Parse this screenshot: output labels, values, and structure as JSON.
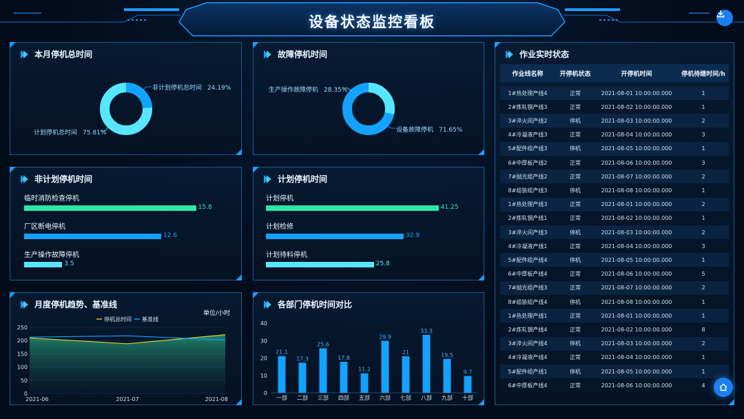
{
  "header": {
    "title": "设备状态监控看板"
  },
  "icons": {
    "download": "download-icon",
    "home": "home-icon",
    "panel_marker": "play-arrow-icon"
  },
  "colors": {
    "accent": "#1e9bff",
    "green": "#2ee6a6",
    "blue": "#13a2ff",
    "cyan": "#57e6ff",
    "yellow": "#d7d02c"
  },
  "panels": {
    "monthly_downtime": {
      "title": "本月停机总时间",
      "slices": [
        {
          "name": "非计划停机总时间",
          "pct": "24.19%",
          "value": 24.19,
          "color": "#13a2ff"
        },
        {
          "name": "计划停机总时间",
          "pct": "75.81%",
          "value": 75.81,
          "color": "#57e6ff"
        }
      ]
    },
    "fault_downtime": {
      "title": "故障停机时间",
      "slices": [
        {
          "name": "生产操作故障停机",
          "pct": "28.35%",
          "value": 28.35,
          "color": "#57e6ff"
        },
        {
          "name": "设备故障停机",
          "pct": "71.65%",
          "value": 71.65,
          "color": "#13a2ff"
        }
      ]
    },
    "unplanned": {
      "title": "非计划停机时间",
      "items": [
        {
          "label": "临时消防检查停机",
          "value": 15.8,
          "value_text": "15.8",
          "color": "#2ee6a6"
        },
        {
          "label": "厂区断电停机",
          "value": 12.6,
          "value_text": "12.6",
          "color": "#13a2ff"
        },
        {
          "label": "生产操作故障停机",
          "value": 3.5,
          "value_text": "3.5",
          "color": "#57e6ff"
        }
      ],
      "max": 20
    },
    "planned": {
      "title": "计划停机时间",
      "items": [
        {
          "label": "计划停机",
          "value": 41.25,
          "value_text": "41.25",
          "color": "#2ee6a6"
        },
        {
          "label": "计划检修",
          "value": 32.9,
          "value_text": "32.9",
          "color": "#13a2ff"
        },
        {
          "label": "计划待料停机",
          "value": 25.8,
          "value_text": "25.8",
          "color": "#57e6ff"
        }
      ],
      "max": 52
    },
    "trend": {
      "title": "月度停机趋势、基准线",
      "unit": "单位/小时",
      "legend": [
        "停机总时间",
        "基准线"
      ]
    },
    "dept": {
      "title": "各部门停机时间对比"
    },
    "realtime": {
      "title": "作业实时状态",
      "columns": [
        "作业线名称",
        "开停机状态",
        "开停机时间",
        "停机待继时间/h"
      ],
      "rows": [
        [
          "1#热处理产线4",
          "正常",
          "2021-08-01 10:00:00.000",
          "1"
        ],
        [
          "2#炼轧钢产线3",
          "正常",
          "2021-08-02 10:00:00.000",
          "1"
        ],
        [
          "3#淬火间产线2",
          "停机",
          "2021-08-03 10:00:00.000",
          "2"
        ],
        [
          "4#冷凝液产线3",
          "正常",
          "2021-08-04 10:00:00.000",
          "3"
        ],
        [
          "5#配件组产线3",
          "停机",
          "2021-08-05 10:00:00.000",
          "1"
        ],
        [
          "6#中厚板产线2",
          "正常",
          "2021-08-06 10:00:00.000",
          "3"
        ],
        [
          "7#抛光组产线2",
          "正常",
          "2021-08-07 10:00:00.000",
          "2"
        ],
        [
          "8#组装组产线3",
          "停机",
          "2021-08-08 10:00:00.000",
          "1"
        ],
        [
          "1#热处理产线3",
          "正常",
          "2021-08-01 10:00:00.000",
          "2"
        ],
        [
          "2#炼轧钢产线1",
          "正常",
          "2021-08-02 10:00:00.000",
          "1"
        ],
        [
          "3#淬火间产线3",
          "停机",
          "2021-08-03 10:00:00.000",
          "2"
        ],
        [
          "4#冷凝液产线1",
          "正常",
          "2021-08-04 10:00:00.000",
          "3"
        ],
        [
          "5#配件组产线4",
          "停机",
          "2021-08-05 10:00:00.000",
          "1"
        ],
        [
          "6#中厚板产线4",
          "正常",
          "2021-08-06 10:00:00.000",
          "5"
        ],
        [
          "7#抛光组产线3",
          "正常",
          "2021-08-07 10:00:00.000",
          "2"
        ],
        [
          "8#组装组产线4",
          "停机",
          "2021-08-08 10:00:00.000",
          "1"
        ],
        [
          "1#热处理产线1",
          "正常",
          "2021-08-01 10:00:00.000",
          "1"
        ],
        [
          "2#炼轧钢产线4",
          "正常",
          "2021-08-02 10:00:00.000",
          "8"
        ],
        [
          "3#淬火间产线4",
          "停机",
          "2021-08-03 10:00:00.000",
          "2"
        ],
        [
          "4#冷凝液产线4",
          "正常",
          "2021-08-04 10:00:00.000",
          "1"
        ],
        [
          "5#配件组产线1",
          "停机",
          "2021-08-05 10:00:00.000",
          "1"
        ],
        [
          "6#中厚板产线4",
          "正常",
          "2021-08-06 10:00:00.000",
          "4"
        ]
      ]
    }
  },
  "chart_data": [
    {
      "type": "area",
      "title": "月度停机趋势、基准线",
      "ylabel": "单位/小时",
      "x": [
        "2021-06",
        "2021-07",
        "2021-08"
      ],
      "ylim": [
        0,
        250
      ],
      "yticks": [
        0,
        50,
        100,
        150,
        200,
        250
      ],
      "series": [
        {
          "name": "停机总时间",
          "values": [
            210,
            188,
            222
          ],
          "color": "#d7d02c"
        },
        {
          "name": "基准线",
          "values": [
            213,
            218,
            202
          ],
          "color": "#13a2ff"
        }
      ],
      "legend": "top-right"
    },
    {
      "type": "bar",
      "title": "各部门停机时间对比",
      "categories": [
        "一部",
        "二部",
        "三部",
        "四部",
        "五部",
        "六部",
        "七部",
        "八部",
        "九部",
        "十部"
      ],
      "values": [
        21.1,
        17.3,
        25.6,
        17.8,
        11.2,
        29.9,
        21,
        33.3,
        19.5,
        9.7
      ],
      "labels": [
        "21.1",
        "17.3",
        "25.6",
        "17.8",
        "11.2",
        "29.9",
        "21",
        "33.3",
        "19.5",
        "9.7"
      ],
      "ylim": [
        0,
        40
      ],
      "yticks": [
        0,
        10,
        20,
        30,
        40
      ],
      "color": "#13a2ff"
    }
  ]
}
